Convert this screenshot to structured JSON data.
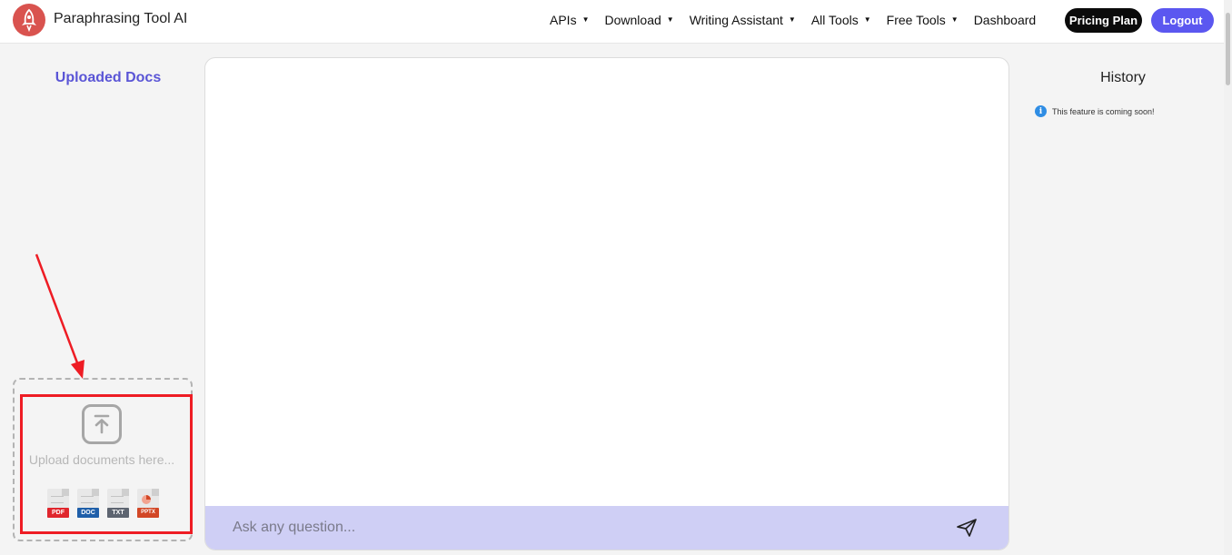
{
  "header": {
    "brand": "Paraphrasing Tool AI",
    "logo_icon": "rocket-icon",
    "nav": [
      {
        "label": "APIs",
        "has_dropdown": true
      },
      {
        "label": "Download",
        "has_dropdown": true
      },
      {
        "label": "Writing Assistant",
        "has_dropdown": true
      },
      {
        "label": "All Tools",
        "has_dropdown": true
      },
      {
        "label": "Free Tools",
        "has_dropdown": true
      },
      {
        "label": "Dashboard",
        "has_dropdown": false
      }
    ],
    "pricing_label": "Pricing Plan",
    "logout_label": "Logout"
  },
  "left_panel": {
    "title": "Uploaded Docs",
    "upload_text": "Upload documents here...",
    "file_types": [
      "PDF",
      "DOC",
      "TXT",
      "PPTX"
    ]
  },
  "chat": {
    "placeholder": "Ask any question..."
  },
  "history": {
    "title": "History",
    "notice": "This feature is coming soon!"
  },
  "colors": {
    "accent": "#5b57f0",
    "title_accent": "#5a55d6",
    "input_bar": "#cfcff5",
    "highlight": "#ee1c24",
    "pdf": "#e0262d",
    "doc": "#1f5fa9",
    "txt": "#5d6470",
    "pptx": "#d24726"
  }
}
